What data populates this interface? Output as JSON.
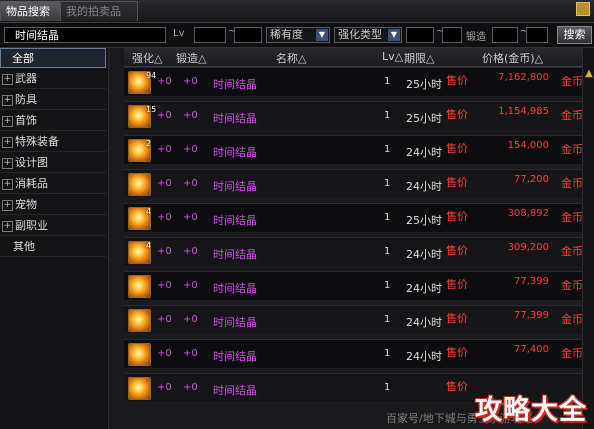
{
  "tabs": [
    "物品搜索",
    "我的拍卖品"
  ],
  "search": {
    "value": "时间结晶"
  },
  "filters": {
    "lv_label": "Lv",
    "tilde": "~",
    "rarity": "稀有度",
    "upgrade_type": "强化类型",
    "forge": "锻造",
    "search_button": "搜索",
    "dropdown_arrow": "▼"
  },
  "sidebar": {
    "items": [
      {
        "label": "全部",
        "selected": true,
        "expandable": false
      },
      {
        "label": "武器",
        "selected": false,
        "expandable": true
      },
      {
        "label": "防具",
        "selected": false,
        "expandable": true
      },
      {
        "label": "首饰",
        "selected": false,
        "expandable": true
      },
      {
        "label": "特殊装备",
        "selected": false,
        "expandable": true
      },
      {
        "label": "设计图",
        "selected": false,
        "expandable": true
      },
      {
        "label": "消耗品",
        "selected": false,
        "expandable": true
      },
      {
        "label": "宠物",
        "selected": false,
        "expandable": true
      },
      {
        "label": "副职业",
        "selected": false,
        "expandable": true
      },
      {
        "label": "其他",
        "selected": false,
        "expandable": false
      }
    ]
  },
  "list": {
    "headers": {
      "strength": "强化△",
      "forge": "锻造△",
      "name": "名称△",
      "level": "Lv△",
      "duration": "期限△",
      "price": "价格(金币)△"
    },
    "rows": [
      {
        "stack": "94",
        "strength": "+0",
        "forge": "+0",
        "name": "时间结晶",
        "level": "1",
        "duration": "25小时",
        "type": "售价",
        "price": "7,162,800",
        "currency": "金币"
      },
      {
        "stack": "15",
        "strength": "+0",
        "forge": "+0",
        "name": "时间结晶",
        "level": "1",
        "duration": "25小时",
        "type": "售价",
        "price": "1,154,985",
        "currency": "金币"
      },
      {
        "stack": "2",
        "strength": "+0",
        "forge": "+0",
        "name": "时间结晶",
        "level": "1",
        "duration": "24小时",
        "type": "售价",
        "price": "154,000",
        "currency": "金币"
      },
      {
        "stack": "",
        "strength": "+0",
        "forge": "+0",
        "name": "时间结晶",
        "level": "1",
        "duration": "24小时",
        "type": "售价",
        "price": "77,200",
        "currency": "金币"
      },
      {
        "stack": "4",
        "strength": "+0",
        "forge": "+0",
        "name": "时间结晶",
        "level": "1",
        "duration": "25小时",
        "type": "售价",
        "price": "308,892",
        "currency": "金币"
      },
      {
        "stack": "4",
        "strength": "+0",
        "forge": "+0",
        "name": "时间结晶",
        "level": "1",
        "duration": "24小时",
        "type": "售价",
        "price": "309,200",
        "currency": "金币"
      },
      {
        "stack": "",
        "strength": "+0",
        "forge": "+0",
        "name": "时间结晶",
        "level": "1",
        "duration": "24小时",
        "type": "售价",
        "price": "77,399",
        "currency": "金币"
      },
      {
        "stack": "",
        "strength": "+0",
        "forge": "+0",
        "name": "时间结晶",
        "level": "1",
        "duration": "24小时",
        "type": "售价",
        "price": "77,399",
        "currency": "金币"
      },
      {
        "stack": "",
        "strength": "+0",
        "forge": "+0",
        "name": "时间结晶",
        "level": "1",
        "duration": "24小时",
        "type": "售价",
        "price": "77,400",
        "currency": "金币"
      },
      {
        "stack": "",
        "strength": "+0",
        "forge": "+0",
        "name": "时间结晶",
        "level": "1",
        "duration": "",
        "type": "售价",
        "price": "",
        "currency": ""
      }
    ]
  },
  "footer": {
    "text": "百家号/地下城与勇士手游攻略"
  },
  "watermark": "攻略大全",
  "colors": {
    "item_name": "#d04ae8",
    "price": "#ff3a3a",
    "accent_blue": "#3a4f7a"
  }
}
